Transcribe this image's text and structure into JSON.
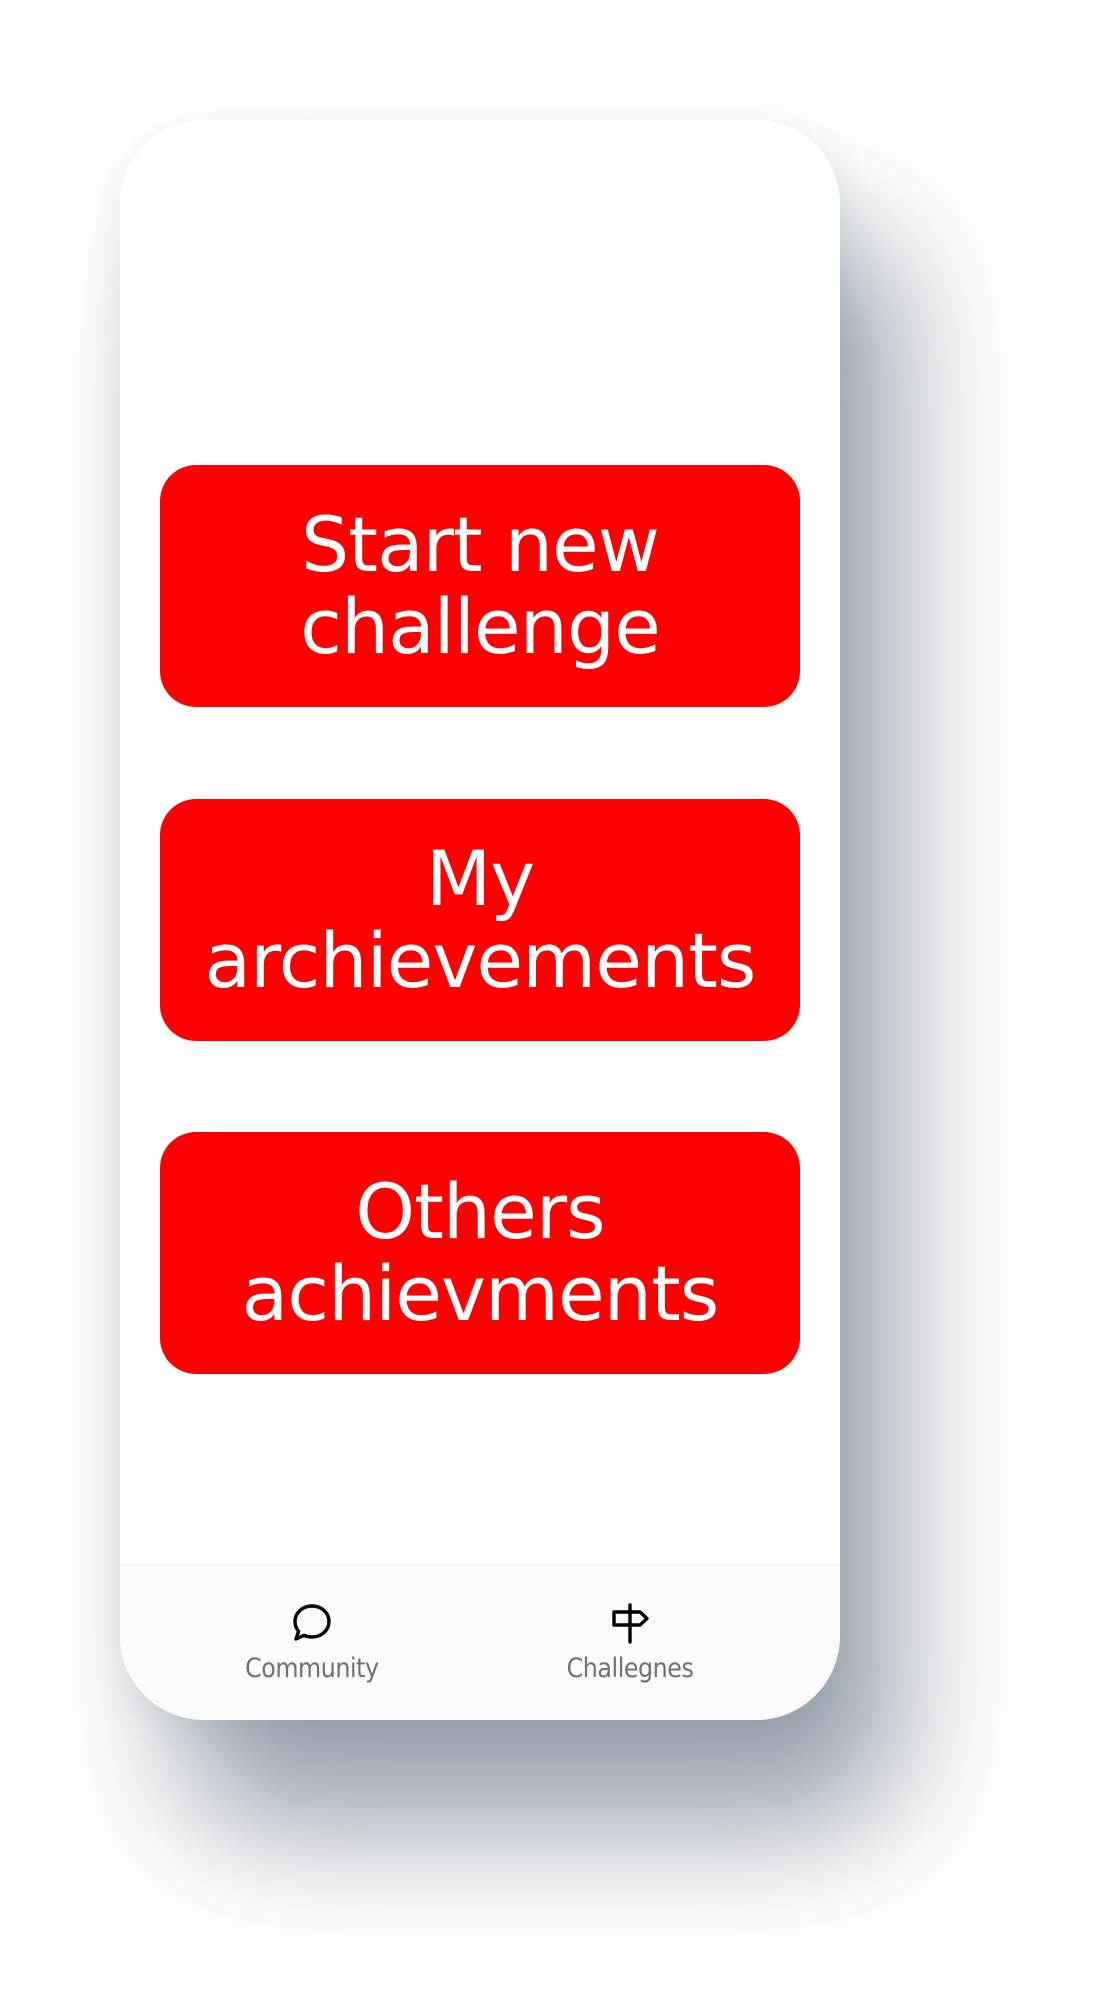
{
  "screen": {
    "buttons": [
      {
        "label": "Start new\nchallenge"
      },
      {
        "label": "My\narchievements"
      },
      {
        "label": "Others\nachievments"
      }
    ]
  },
  "tabbar": {
    "tabs": [
      {
        "label": "Community",
        "icon": "chat-bubble-icon"
      },
      {
        "label": "Challegnes",
        "icon": "signpost-icon"
      }
    ]
  },
  "colors": {
    "accent": "#ff0000",
    "button_text": "#ffffff",
    "tab_label": "#6f6f6f",
    "background": "#ffffff"
  }
}
